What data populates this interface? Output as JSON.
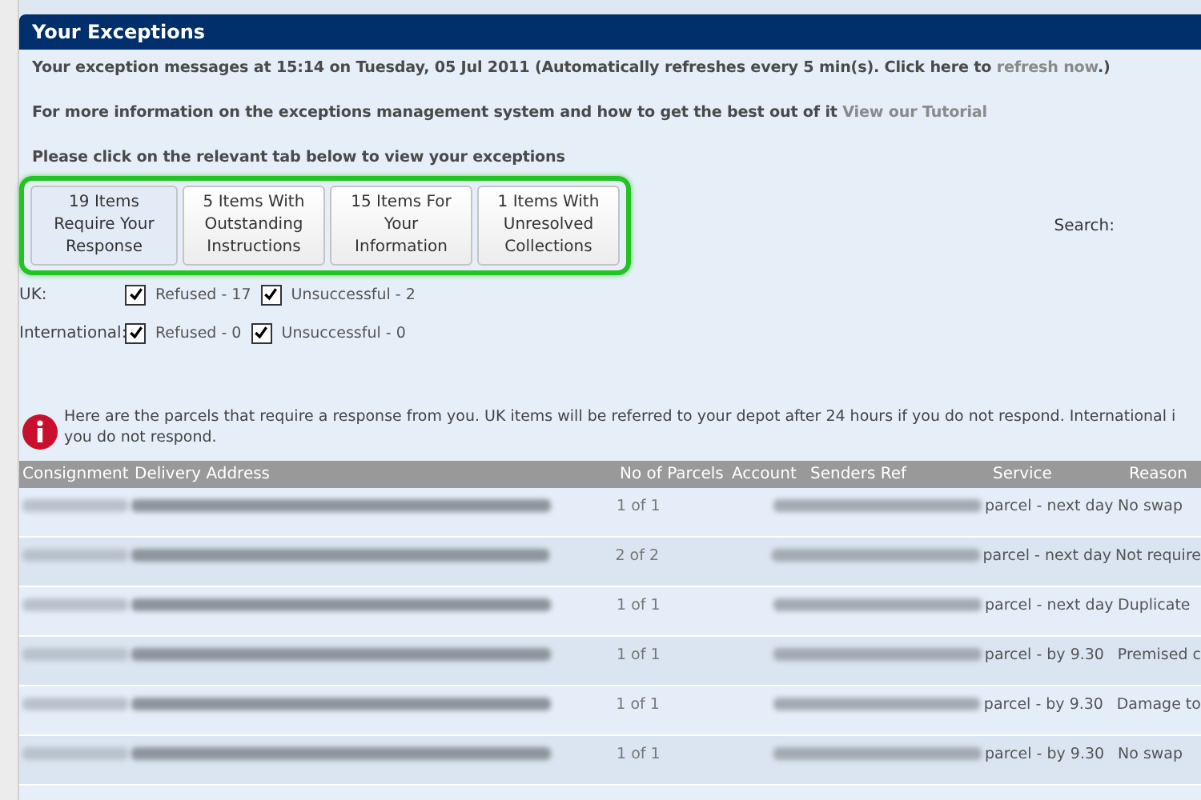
{
  "panel": {
    "title": "Your Exceptions"
  },
  "intro": [
    {
      "text": "Your exception messages at 15:14 on Tuesday, 05 Jul 2011 (Automatically refreshes every 5 min(s). Click here to ",
      "link": "refresh now",
      "after": ".)"
    },
    {
      "text": "For more information on the exceptions management system and how to get the best out of it ",
      "link": "View our Tutorial"
    }
  ],
  "instruction": "Please click on the relevant tab below to view your exceptions",
  "tabs": [
    {
      "label": "19 Items Require Your Response",
      "selected": true
    },
    {
      "label": "5 Items With Outstanding Instructions",
      "selected": false
    },
    {
      "label": "15 Items For Your Information",
      "selected": false
    },
    {
      "label": "1 Items With Unresolved Collections",
      "selected": false
    }
  ],
  "search": {
    "label": "Search:"
  },
  "filters": [
    {
      "label": "UK:",
      "options": [
        {
          "label": "Refused - 17",
          "checked": true
        },
        {
          "label": "Unsuccessful - 2",
          "checked": true
        }
      ]
    },
    {
      "label": "International:",
      "options": [
        {
          "label": "Refused - 0",
          "checked": true
        },
        {
          "label": "Unsuccessful - 0",
          "checked": true
        }
      ]
    }
  ],
  "notice": {
    "lines": [
      "Here are the parcels that require a response from you. UK items will be referred to your depot after 24 hours if you do not respond. International i",
      "you do not respond."
    ]
  },
  "table": {
    "columns": [
      "Consignment",
      "Delivery Address",
      "No of Parcels",
      "Account",
      "Senders Ref",
      "Service",
      "Reason"
    ],
    "rows": [
      {
        "parcels": "1 of 1",
        "service": "parcel - next day",
        "reason": "No swap"
      },
      {
        "parcels": "2 of 2",
        "service": "parcel - next day",
        "reason": "Not require"
      },
      {
        "parcels": "1 of 1",
        "service": "parcel - next day",
        "reason": "Duplicate"
      },
      {
        "parcels": "1 of 1",
        "service": "parcel - by 9.30",
        "reason": "Premised c"
      },
      {
        "parcels": "1 of 1",
        "service": "parcel - by 9.30",
        "reason": "Damage to"
      },
      {
        "parcels": "1 of 1",
        "service": "parcel - by 9.30",
        "reason": "No swap"
      }
    ]
  }
}
